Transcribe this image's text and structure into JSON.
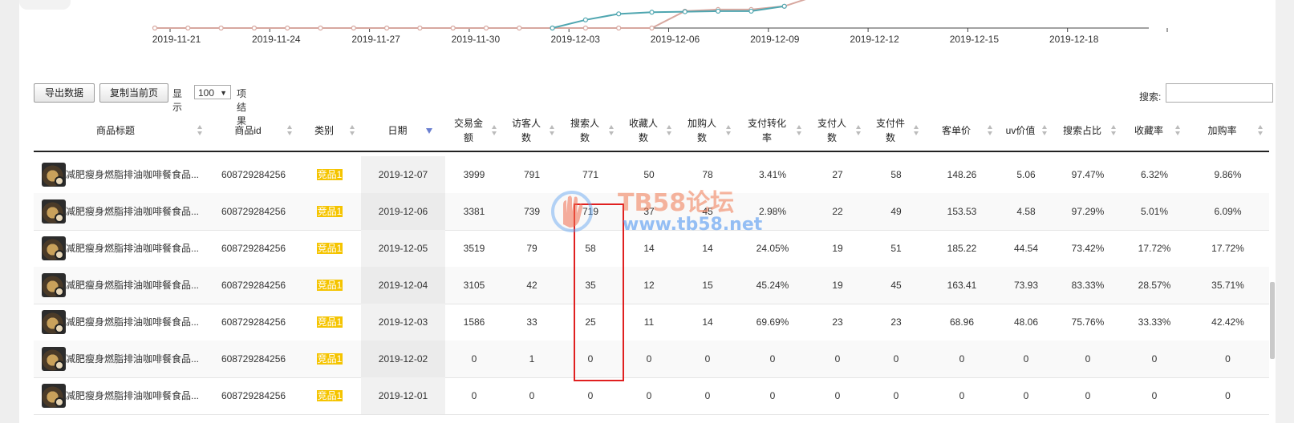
{
  "chart": {
    "x_tick_labels": [
      "2019-11-21",
      "2019-11-24",
      "2019-11-27",
      "2019-11-30",
      "2019-12-03",
      "2019-12-06",
      "2019-12-09",
      "2019-12-12",
      "2019-12-15",
      "2019-12-18"
    ],
    "series_colors": [
      "#d7a79f",
      "#4fa6b0"
    ]
  },
  "chart_data": {
    "type": "line",
    "x": [
      "2019-11-20",
      "2019-11-21",
      "2019-11-22",
      "2019-11-23",
      "2019-11-24",
      "2019-11-25",
      "2019-11-26",
      "2019-11-27",
      "2019-11-28",
      "2019-11-29",
      "2019-11-30",
      "2019-12-01",
      "2019-12-02",
      "2019-12-03",
      "2019-12-04",
      "2019-12-05",
      "2019-12-06",
      "2019-12-07",
      "2019-12-08",
      "2019-12-09",
      "2019-12-10"
    ],
    "series": [
      {
        "values": [
          0,
          0,
          0,
          0,
          0,
          0,
          0,
          0,
          0,
          0,
          0,
          0,
          0,
          0,
          0,
          0,
          0.62,
          0.68,
          0.68,
          0.8,
          1.2
        ]
      },
      {
        "values": [
          null,
          null,
          null,
          null,
          null,
          null,
          null,
          null,
          null,
          null,
          null,
          null,
          0,
          0.3,
          0.52,
          0.58,
          0.6,
          0.62,
          0.62,
          0.8,
          null
        ]
      }
    ]
  },
  "toolbar": {
    "export_label": "导出数据",
    "copy_label": "复制当前页",
    "show_label": "显示",
    "page_size": "100",
    "results_label": "项结果",
    "search_label": "搜索:",
    "search_value": ""
  },
  "table": {
    "columns": [
      {
        "line1": "商品标题",
        "line2": ""
      },
      {
        "line1": "商品id",
        "line2": ""
      },
      {
        "line1": "类别",
        "line2": ""
      },
      {
        "line1": "日期",
        "line2": ""
      },
      {
        "line1": "交易金",
        "line2": "额"
      },
      {
        "line1": "访客人",
        "line2": "数"
      },
      {
        "line1": "搜索人",
        "line2": "数"
      },
      {
        "line1": "收藏人",
        "line2": "数"
      },
      {
        "line1": "加购人",
        "line2": "数"
      },
      {
        "line1": "支付转化",
        "line2": "率"
      },
      {
        "line1": "支付人",
        "line2": "数"
      },
      {
        "line1": "支付件",
        "line2": "数"
      },
      {
        "line1": "客单价",
        "line2": ""
      },
      {
        "line1": "uv价值",
        "line2": ""
      },
      {
        "line1": "搜索占比",
        "line2": ""
      },
      {
        "line1": "收藏率",
        "line2": ""
      },
      {
        "line1": "加购率",
        "line2": ""
      }
    ],
    "rows": [
      [
        "减肥瘦身燃脂排油咖啡餐食品...",
        "608729284256",
        "竞品1",
        "2019-12-07",
        "3999",
        "791",
        "771",
        "50",
        "78",
        "3.41%",
        "27",
        "58",
        "148.26",
        "5.06",
        "97.47%",
        "6.32%",
        "9.86%"
      ],
      [
        "减肥瘦身燃脂排油咖啡餐食品...",
        "608729284256",
        "竞品1",
        "2019-12-06",
        "3381",
        "739",
        "719",
        "37",
        "45",
        "2.98%",
        "22",
        "49",
        "153.53",
        "4.58",
        "97.29%",
        "5.01%",
        "6.09%"
      ],
      [
        "减肥瘦身燃脂排油咖啡餐食品...",
        "608729284256",
        "竞品1",
        "2019-12-05",
        "3519",
        "79",
        "58",
        "14",
        "14",
        "24.05%",
        "19",
        "51",
        "185.22",
        "44.54",
        "73.42%",
        "17.72%",
        "17.72%"
      ],
      [
        "减肥瘦身燃脂排油咖啡餐食品...",
        "608729284256",
        "竞品1",
        "2019-12-04",
        "3105",
        "42",
        "35",
        "12",
        "15",
        "45.24%",
        "19",
        "45",
        "163.41",
        "73.93",
        "83.33%",
        "28.57%",
        "35.71%"
      ],
      [
        "减肥瘦身燃脂排油咖啡餐食品...",
        "608729284256",
        "竞品1",
        "2019-12-03",
        "1586",
        "33",
        "25",
        "11",
        "14",
        "69.69%",
        "23",
        "23",
        "68.96",
        "48.06",
        "75.76%",
        "33.33%",
        "42.42%"
      ],
      [
        "减肥瘦身燃脂排油咖啡餐食品...",
        "608729284256",
        "竞品1",
        "2019-12-02",
        "0",
        "1",
        "0",
        "0",
        "0",
        "0",
        "0",
        "0",
        "0",
        "0",
        "0",
        "0",
        "0"
      ],
      [
        "减肥瘦身燃脂排油咖啡餐食品...",
        "608729284256",
        "竞品1",
        "2019-12-01",
        "0",
        "0",
        "0",
        "0",
        "0",
        "0",
        "0",
        "0",
        "0",
        "0",
        "0",
        "0",
        "0"
      ]
    ]
  },
  "watermark": {
    "title": "TB58论坛",
    "url": "www.tb58.net"
  }
}
